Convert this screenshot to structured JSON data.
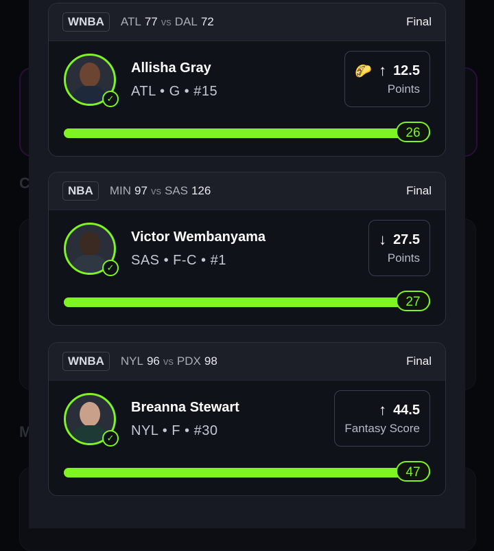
{
  "background": {
    "letters": [
      "C",
      "M"
    ]
  },
  "colors": {
    "accent": "#7ef522",
    "sheet": "#171a22",
    "card": "#0f1218"
  },
  "cards": [
    {
      "league": "WNBA",
      "team1": "ATL",
      "score1": "77",
      "vs": "vs",
      "team2": "DAL",
      "score2": "72",
      "status": "Final",
      "player_name": "Allisha Gray",
      "player_meta": "ATL • G • #15",
      "emoji": "🌮",
      "direction_icon": "arrow-up-icon",
      "arrow": "↑",
      "line": "12.5",
      "stat": "Points",
      "result": "26",
      "progress": 1.0
    },
    {
      "league": "NBA",
      "team1": "MIN",
      "score1": "97",
      "vs": "vs",
      "team2": "SAS",
      "score2": "126",
      "status": "Final",
      "player_name": "Victor Wembanyama",
      "player_meta": "SAS • F-C • #1",
      "emoji": "",
      "direction_icon": "arrow-down-icon",
      "arrow": "↓",
      "line": "27.5",
      "stat": "Points",
      "result": "27",
      "progress": 1.0
    },
    {
      "league": "WNBA",
      "team1": "NYL",
      "score1": "96",
      "vs": "vs",
      "team2": "PDX",
      "score2": "98",
      "status": "Final",
      "player_name": "Breanna Stewart",
      "player_meta": "NYL • F • #30",
      "emoji": "",
      "direction_icon": "arrow-up-icon",
      "arrow": "↑",
      "line": "44.5",
      "stat": "Fantasy Score",
      "result": "47",
      "progress": 1.0
    }
  ]
}
